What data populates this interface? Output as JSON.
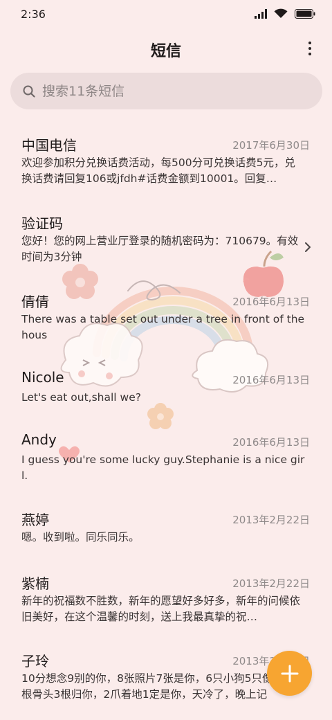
{
  "status_bar": {
    "time": "2:36"
  },
  "header": {
    "title": "短信"
  },
  "search": {
    "placeholder": "搜索11条短信"
  },
  "messages": [
    {
      "name": "中国电信",
      "date": "2017年6月30日",
      "preview": "欢迎参加积分兑换话费活动，每500分可兑换话费5元，兑换话费请回复106或jfdh#话费金额到10001。回复…"
    },
    {
      "name": "验证码",
      "date": "",
      "preview": "您好！您的网上营业厅登录的随机密码为：710679。有效时间为3分钟"
    },
    {
      "name": "倩倩",
      "date": "2016年6月13日",
      "preview": "There was a table set out under a tree in front of the hous"
    },
    {
      "name": "Nicole",
      "date": "2016年6月13日",
      "preview": "Let's eat out,shall we?"
    },
    {
      "name": "Andy",
      "date": "2016年6月13日",
      "preview": "I guess you're some lucky guy.Stephanie is a nice girl."
    },
    {
      "name": "燕婷",
      "date": "2013年2月22日",
      "preview": "嗯。收到啦。同乐同乐。"
    },
    {
      "name": "紫楠",
      "date": "2013年2月22日",
      "preview": "新年的祝福数不胜数，新年的愿望好多好多，新年的问候依旧美好，在这个温馨的时刻，送上我最真挚的祝…"
    },
    {
      "name": "子玲",
      "date": "2013年2月22日",
      "preview": "10分想念9别的你，8张照片7张是你，6只小狗5只像你，4根骨头3根归你，2爪着地1定是你，天冷了，晚上记"
    }
  ],
  "colors": {
    "background": "#fbeceb",
    "search_bg": "#ecdcdc",
    "fab": "#f7a531",
    "date_text": "#8f8a8a"
  },
  "icons": {
    "status": [
      "signal-icon",
      "wifi-icon",
      "battery-icon"
    ],
    "search": "search-icon",
    "more": "more-vertical-icon",
    "chevron": "chevron-right-icon",
    "fab": "plus-icon"
  }
}
